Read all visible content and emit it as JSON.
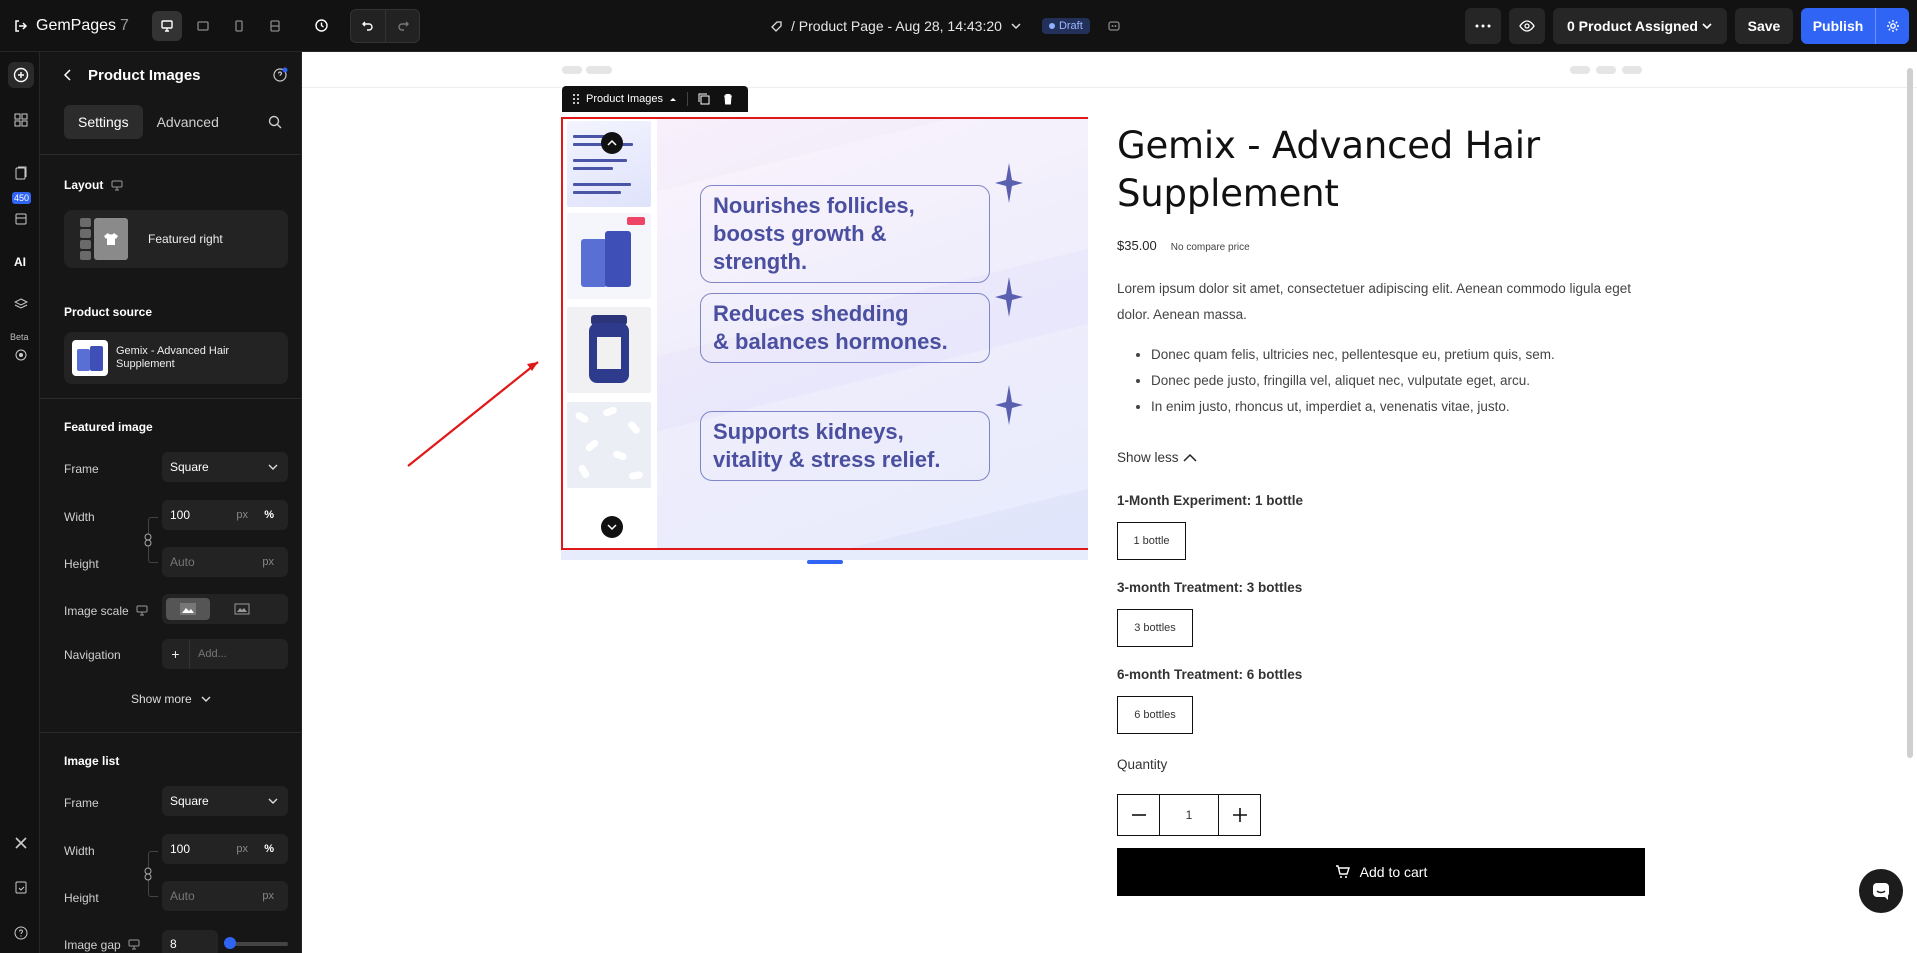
{
  "app": {
    "name": "GemPages",
    "version": "7"
  },
  "topbar": {
    "page_title": "/ Product Page - Aug 28, 14:43:20",
    "status": "Draft",
    "assign_label": "0 Product Assigned",
    "save_label": "Save",
    "publish_label": "Publish"
  },
  "rail": {
    "badge_count": "450",
    "beta_label": "Beta"
  },
  "panel": {
    "title": "Product Images",
    "tabs": [
      {
        "label": "Settings"
      },
      {
        "label": "Advanced"
      }
    ],
    "layout": {
      "label": "Layout",
      "value": "Featured right"
    },
    "product_source": {
      "label": "Product source",
      "value": "Gemix - Advanced Hair Supplement"
    },
    "featured_image": {
      "label": "Featured image",
      "frame_label": "Frame",
      "frame_value": "Square",
      "width_label": "Width",
      "width_value": "100",
      "width_unit_px": "px",
      "width_unit_pct": "%",
      "height_label": "Height",
      "height_placeholder": "Auto",
      "height_unit": "px",
      "image_scale_label": "Image scale",
      "navigation_label": "Navigation",
      "navigation_placeholder": "Add...",
      "show_more": "Show more"
    },
    "image_list": {
      "label": "Image list",
      "frame_label": "Frame",
      "frame_value": "Square",
      "width_label": "Width",
      "width_value": "100",
      "width_unit_px": "px",
      "width_unit_pct": "%",
      "height_label": "Height",
      "height_placeholder": "Auto",
      "height_unit": "px",
      "gap_label": "Image gap",
      "gap_value": "8"
    }
  },
  "canvas": {
    "element_label": "Product Images",
    "benefits": [
      {
        "line1": "Nourishes follicles,",
        "line2": "boosts growth & strength."
      },
      {
        "line1": "Reduces shedding",
        "line2": "& balances hormones."
      },
      {
        "line1": "Supports kidneys,",
        "line2": "vitality & stress relief."
      }
    ],
    "product": {
      "title": "Gemix - Advanced Hair Supplement",
      "price": "$35.00",
      "compare": "No compare price",
      "description": "Lorem ipsum dolor sit amet, consectetuer adipiscing elit. Aenean commodo ligula eget dolor. Aenean massa.",
      "bullets": [
        "Donec quam felis, ultricies nec, pellentesque eu, pretium quis, sem.",
        "Donec pede justo, fringilla vel, aliquet nec, vulputate eget, arcu.",
        "In enim justo, rhoncus ut, imperdiet a, venenatis vitae, justo."
      ],
      "show_less": "Show less",
      "options": [
        {
          "title": "1-Month Experiment: 1 bottle",
          "value": "1 bottle"
        },
        {
          "title": "3-month Treatment: 3 bottles",
          "value": "3 bottles"
        },
        {
          "title": "6-month Treatment: 6 bottles",
          "value": "6 bottles"
        }
      ],
      "quantity_label": "Quantity",
      "quantity_value": "1",
      "add_to_cart": "Add to cart"
    }
  },
  "colors": {
    "accent": "#2f64f5",
    "selection": "#e01818",
    "benefit_text": "#4a4f9f"
  }
}
